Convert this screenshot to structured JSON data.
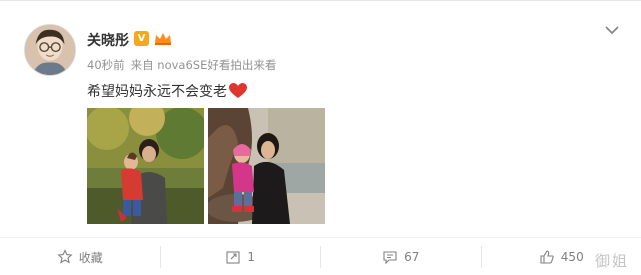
{
  "post": {
    "author_name": "关晓彤",
    "verified_badge": "V",
    "time": "40秒前",
    "source": "来自 nova6SE好看拍出来看",
    "text": "希望妈妈永远不会变老"
  },
  "actions": {
    "favorite_label": "收藏",
    "repost_count": "1",
    "comment_count": "67",
    "like_count": "450"
  },
  "watermark": "御姐",
  "colors": {
    "verified": "#f7a816",
    "heart": "#e0342f",
    "meta_text": "#939393"
  },
  "icons": [
    "chevron-down-icon",
    "star-icon",
    "repost-icon",
    "comment-icon",
    "like-icon",
    "heart-icon"
  ]
}
